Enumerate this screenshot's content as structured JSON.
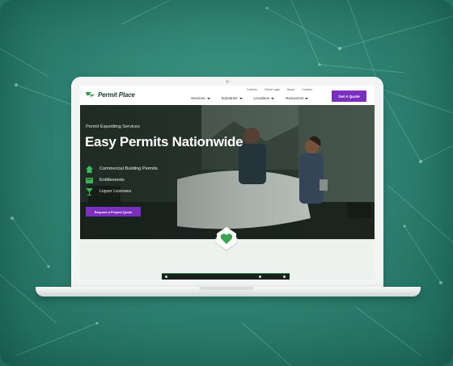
{
  "site": {
    "logo_text": "Permit Place",
    "top_links": [
      "Careers",
      "Client Login",
      "About",
      "Contact"
    ],
    "nav": [
      "Services",
      "Industries",
      "Locations",
      "Resources"
    ],
    "quote_button": "Get A Quote"
  },
  "hero": {
    "subtitle": "Permit Expediting Services",
    "title": "Easy Permits Nationwide",
    "features": [
      {
        "icon": "building-icon",
        "label": "Commercial Building Permits"
      },
      {
        "icon": "certificate-icon",
        "label": "Entitlements"
      },
      {
        "icon": "cocktail-icon",
        "label": "Liquor Licenses"
      }
    ],
    "cta_button": "Request a Project Quote"
  },
  "colors": {
    "brand_green": "#2f9a4e",
    "accent_purple": "#7b2fbf",
    "backdrop_teal": "#2c7f70"
  }
}
